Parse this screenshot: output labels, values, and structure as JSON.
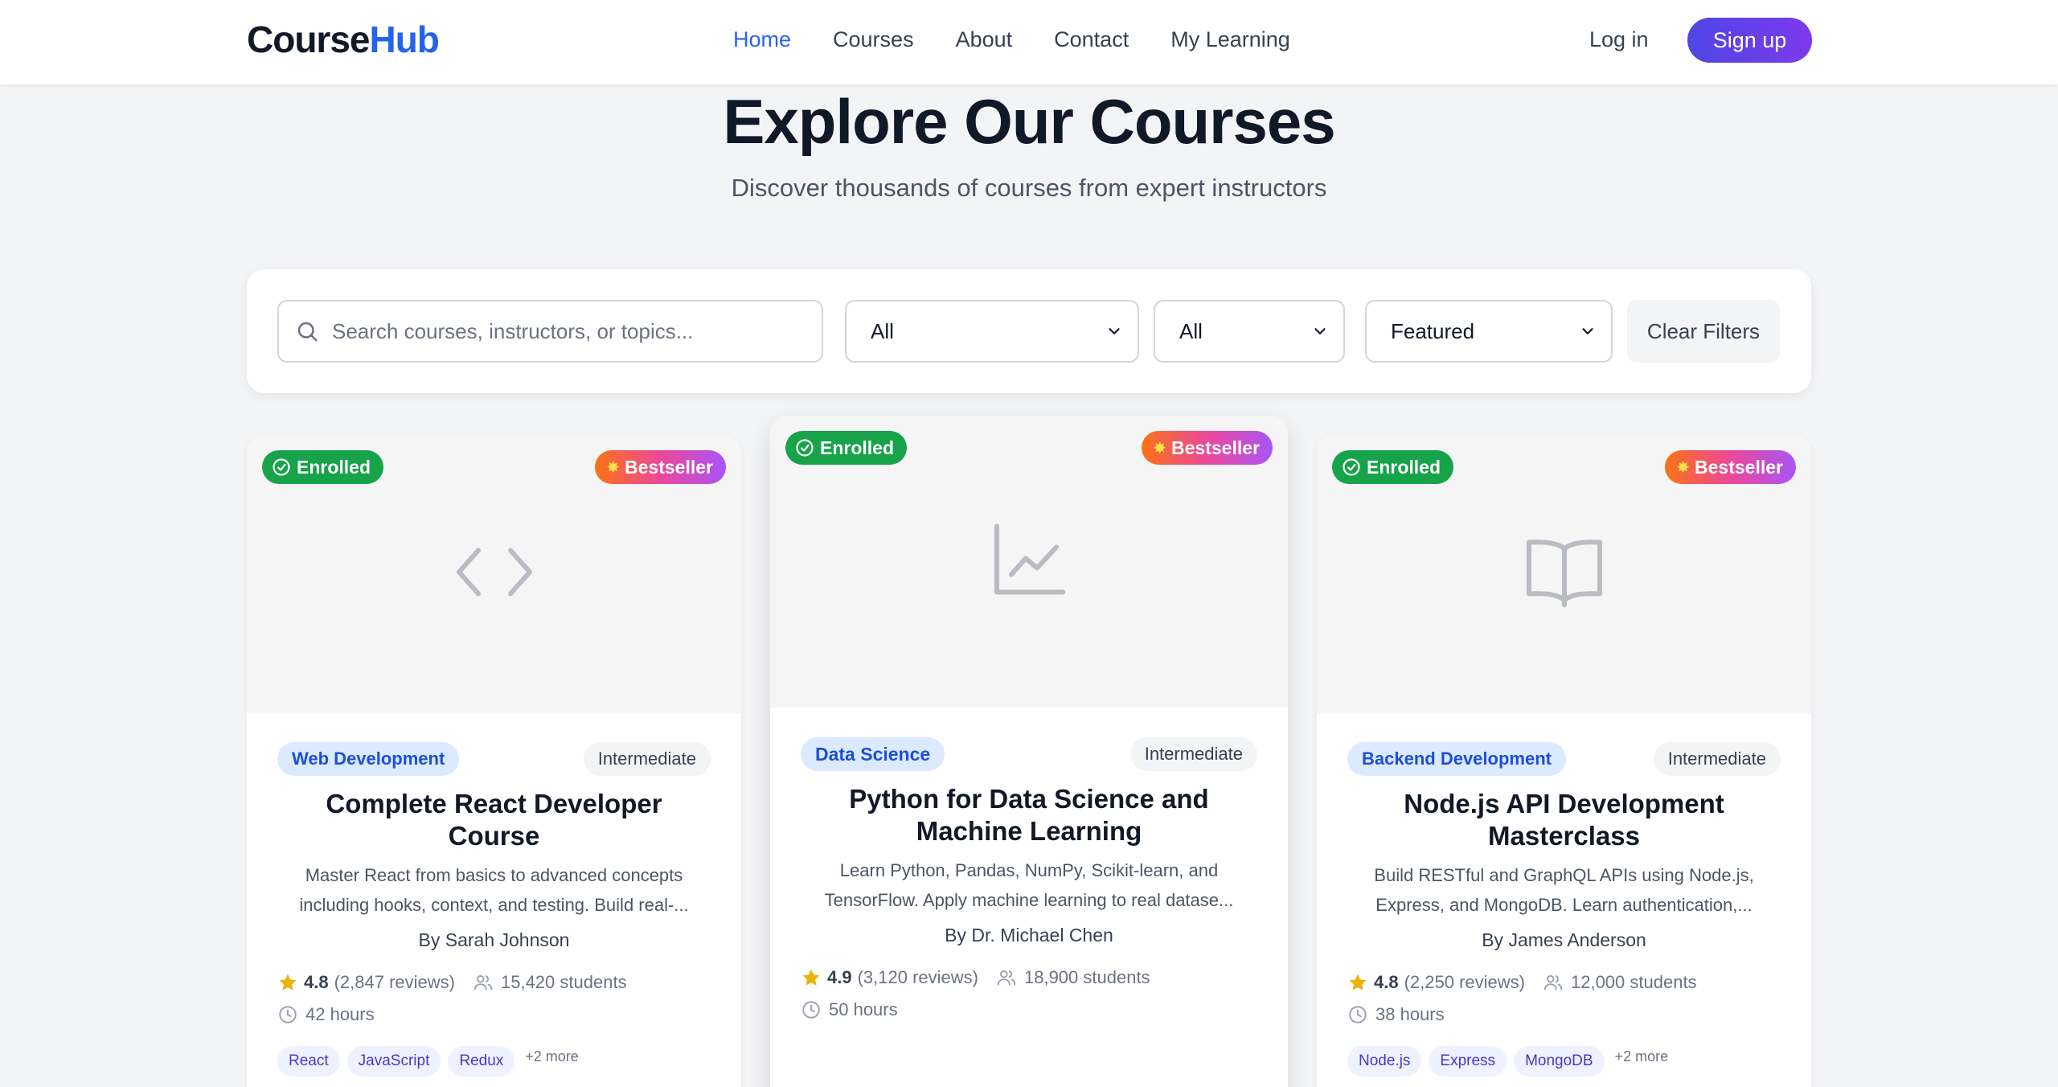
{
  "header": {
    "logo_main": "Course",
    "logo_accent": "Hub",
    "nav": [
      "Home",
      "Courses",
      "About",
      "Contact",
      "My Learning"
    ],
    "active_nav": "Home",
    "login": "Log in",
    "signup": "Sign up"
  },
  "hero": {
    "title": "Explore Our Courses",
    "subtitle": "Discover thousands of courses from expert instructors"
  },
  "filters": {
    "search_placeholder": "Search courses, instructors, or topics...",
    "category": "All",
    "level": "All",
    "sort": "Featured",
    "clear": "Clear Filters"
  },
  "badges": {
    "enrolled": "Enrolled",
    "bestseller": "Bestseller"
  },
  "courses": [
    {
      "icon": "code-icon",
      "category": "Web Development",
      "level": "Intermediate",
      "title": "Complete React Developer Course",
      "description": "Master React from basics to advanced concepts including hooks, context, and testing. Build real-...",
      "author": "By Sarah Johnson",
      "rating": "4.8",
      "reviews": "(2,847 reviews)",
      "students": "15,420 students",
      "hours": "42 hours",
      "skills": [
        "React",
        "JavaScript",
        "Redux"
      ],
      "more": "+2 more"
    },
    {
      "icon": "chart-line-icon",
      "category": "Data Science",
      "level": "Intermediate",
      "title": "Python for Data Science and Machine Learning",
      "description": "Learn Python, Pandas, NumPy, Scikit-learn, and TensorFlow. Apply machine learning to real datase...",
      "author": "By Dr. Michael Chen",
      "rating": "4.9",
      "reviews": "(3,120 reviews)",
      "students": "18,900 students",
      "hours": "50 hours",
      "skills": [],
      "more": ""
    },
    {
      "icon": "book-icon",
      "category": "Backend Development",
      "level": "Intermediate",
      "title": "Node.js API Development Masterclass",
      "description": "Build RESTful and GraphQL APIs using Node.js, Express, and MongoDB. Learn authentication,...",
      "author": "By James Anderson",
      "rating": "4.8",
      "reviews": "(2,250 reviews)",
      "students": "12,000 students",
      "hours": "38 hours",
      "skills": [
        "Node.js",
        "Express",
        "MongoDB"
      ],
      "more": "+2 more"
    }
  ]
}
